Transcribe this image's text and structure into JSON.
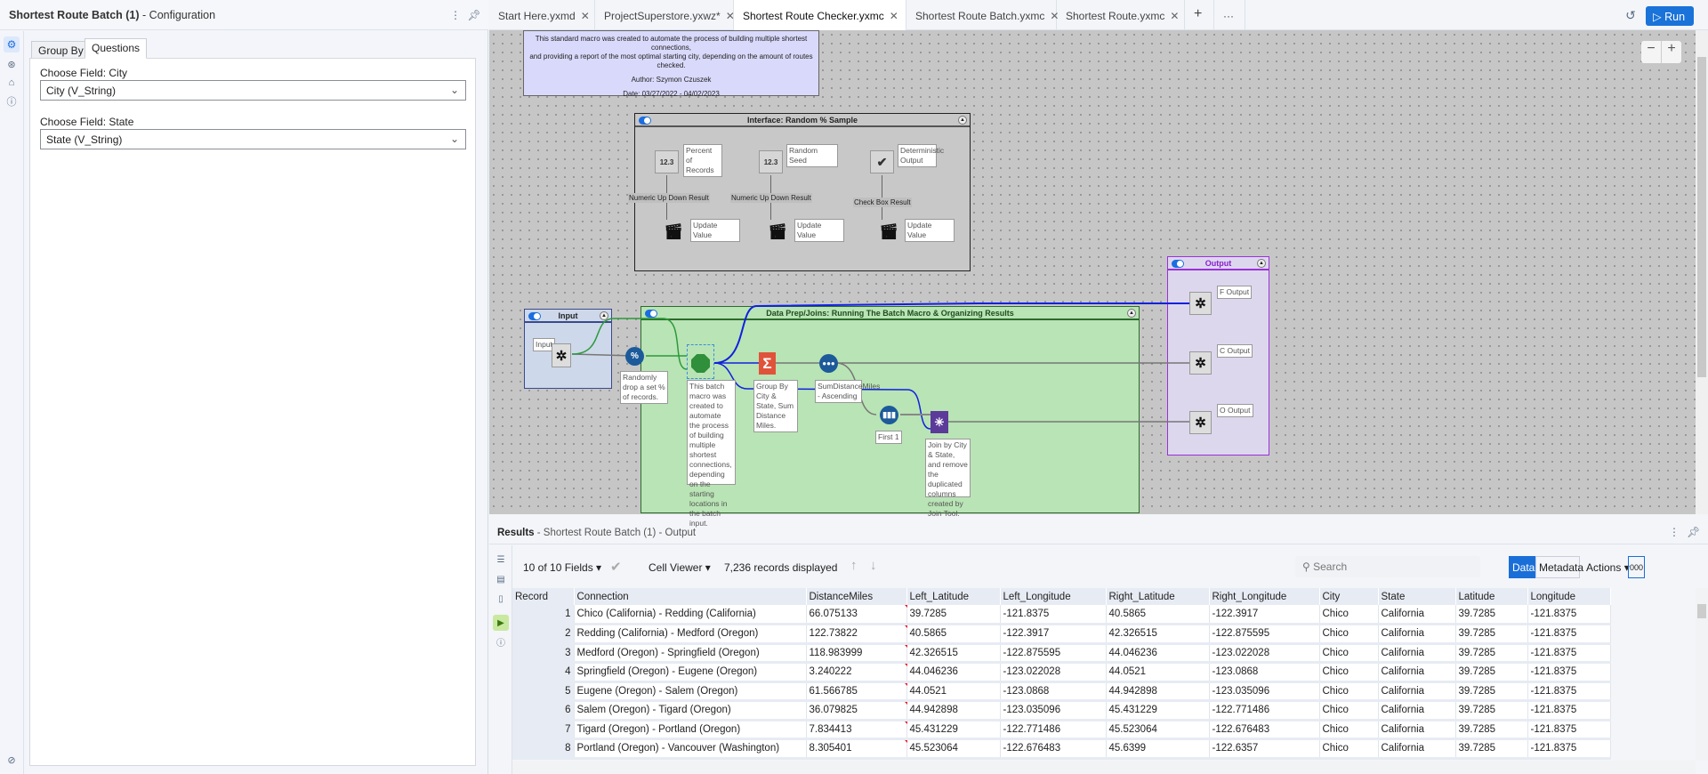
{
  "config_panel": {
    "title": "Shortest Route Batch (1)",
    "subtitle": "- Configuration",
    "tabs": [
      "Group By",
      "Questions"
    ],
    "active_tab": "Questions",
    "fields": [
      {
        "label": "Choose Field: City",
        "value": "City (V_String)"
      },
      {
        "label": "Choose Field: State",
        "value": "State (V_String)"
      }
    ]
  },
  "doc_tabs": [
    {
      "label": "Start Here.yxmd"
    },
    {
      "label": "ProjectSuperstore.yxwz*"
    },
    {
      "label": "Shortest Route Checker.yxmc",
      "active": true
    },
    {
      "label": "Shortest Route Batch.yxmc"
    },
    {
      "label": "Shortest Route.yxmc"
    }
  ],
  "toolbar": {
    "run_label": "Run",
    "add_tab": "+",
    "more": "···",
    "zoom_out": "−",
    "zoom_in": "+"
  },
  "canvas": {
    "comment": [
      "This standard macro was created to automate the process of building multiple shortest connections,",
      "and providing a report of the most optimal starting city, depending on the amount of routes checked.",
      "Author: Szymon Czuszek",
      "Date: 03/27/2022 - 04/02/2023"
    ],
    "interface_container": {
      "title": "Interface: Random % Sample",
      "items": [
        {
          "label": "Percent of Records",
          "result": "Numeric Up Down Result",
          "action": "Update Value",
          "glyph": "12.3"
        },
        {
          "label": "Random Seed",
          "result": "Numeric Up Down Result",
          "action": "Update Value",
          "glyph": "12.3"
        },
        {
          "label": "Deterministic Output",
          "result": "Check Box Result",
          "action": "Update Value",
          "glyph": "✔"
        }
      ]
    },
    "input_container": {
      "title": "Input",
      "node_label": "Input"
    },
    "prep_container": {
      "title": "Data Prep/Joins: Running The Batch Macro & Organizing Results",
      "sample_note": "Randomly drop a set % of records.",
      "macro_note": "This batch macro was created to automate the process of building multiple shortest connections, depending on the starting locations in the batch input.",
      "summarize_note": "Group By City & State, Sum Distance Miles.",
      "sort_note": "SumDistanceMiles - Ascending",
      "first_note": "First 1",
      "join_note": "Join by City & State, and remove the duplicated columns created by Join Tool."
    },
    "output_container": {
      "title": "Output",
      "outputs": [
        "F Output",
        "C Output",
        "O Output"
      ]
    },
    "colors": {
      "comment_bg": "#d9d9fb",
      "prep_bg": "#b9e4b5",
      "input_bg": "#cdd8ea",
      "output_bg": "#ddd7ee",
      "output_border": "#9b30d9",
      "conn_blue": "#1020e0",
      "conn_green": "#2a9a3a"
    }
  },
  "results": {
    "title": "Results",
    "subtitle": "- Shortest Route Batch (1) - Output",
    "fields": "10 of 10 Fields",
    "viewer": "Cell Viewer",
    "records": "7,236 records displayed",
    "search_placeholder": "Search",
    "data_btn": "Data",
    "metadata_btn": "Metadata",
    "actions": "Actions",
    "more": "000",
    "columns": [
      "Record",
      "Connection",
      "DistanceMiles",
      "Left_Latitude",
      "Left_Longitude",
      "Right_Latitude",
      "Right_Longitude",
      "City",
      "State",
      "Latitude",
      "Longitude"
    ],
    "rows": [
      [
        "1",
        "Chico (California) - Redding (California)",
        "66.075133",
        "39.7285",
        "-121.8375",
        "40.5865",
        "-122.3917",
        "Chico",
        "California",
        "39.7285",
        "-121.8375"
      ],
      [
        "2",
        "Redding (California) - Medford (Oregon)",
        "122.73822",
        "40.5865",
        "-122.3917",
        "42.326515",
        "-122.875595",
        "Chico",
        "California",
        "39.7285",
        "-121.8375"
      ],
      [
        "3",
        "Medford (Oregon) - Springfield (Oregon)",
        "118.983999",
        "42.326515",
        "-122.875595",
        "44.046236",
        "-123.022028",
        "Chico",
        "California",
        "39.7285",
        "-121.8375"
      ],
      [
        "4",
        "Springfield (Oregon) - Eugene (Oregon)",
        "3.240222",
        "44.046236",
        "-123.022028",
        "44.0521",
        "-123.0868",
        "Chico",
        "California",
        "39.7285",
        "-121.8375"
      ],
      [
        "5",
        "Eugene (Oregon) - Salem (Oregon)",
        "61.566785",
        "44.0521",
        "-123.0868",
        "44.942898",
        "-123.035096",
        "Chico",
        "California",
        "39.7285",
        "-121.8375"
      ],
      [
        "6",
        "Salem (Oregon) - Tigard (Oregon)",
        "36.079825",
        "44.942898",
        "-123.035096",
        "45.431229",
        "-122.771486",
        "Chico",
        "California",
        "39.7285",
        "-121.8375"
      ],
      [
        "7",
        "Tigard (Oregon) - Portland (Oregon)",
        "7.834413",
        "45.431229",
        "-122.771486",
        "45.523064",
        "-122.676483",
        "Chico",
        "California",
        "39.7285",
        "-121.8375"
      ],
      [
        "8",
        "Portland (Oregon) - Vancouver (Washington)",
        "8.305401",
        "45.523064",
        "-122.676483",
        "45.6399",
        "-122.6357",
        "Chico",
        "California",
        "39.7285",
        "-121.8375"
      ]
    ]
  }
}
